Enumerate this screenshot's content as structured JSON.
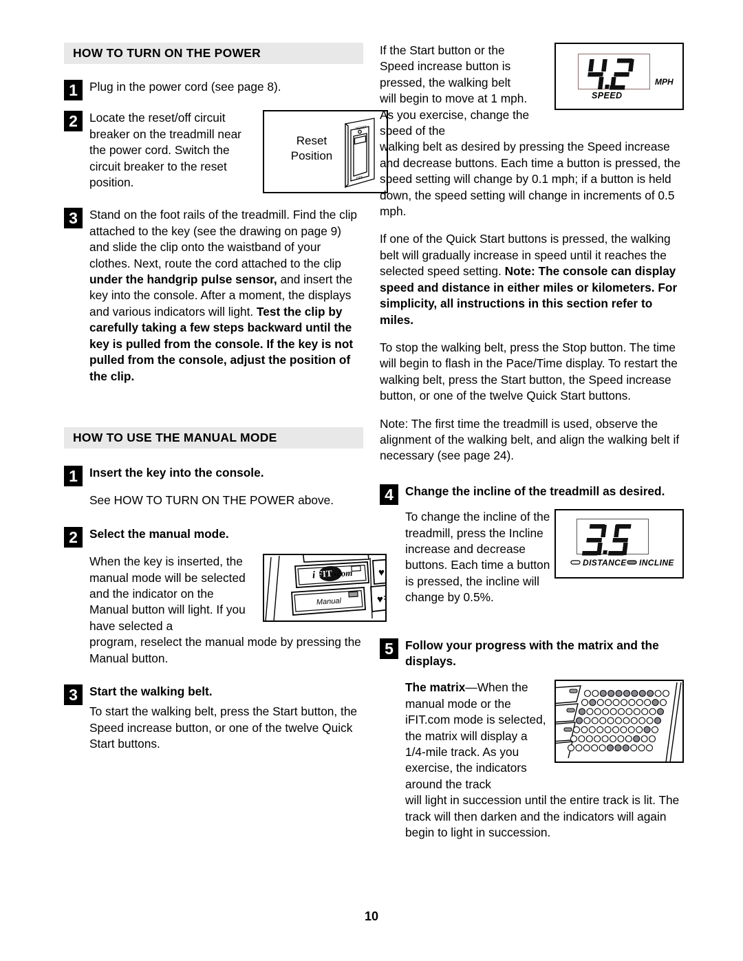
{
  "page": {
    "number": "10"
  },
  "left_column": {
    "section1": {
      "heading": "HOW TO TURN ON THE POWER",
      "steps": [
        {
          "num": "1",
          "text": "Plug in the power cord (see page 8)."
        },
        {
          "num": "2",
          "text": "Locate the reset/off circuit breaker on the treadmill near the power cord. Switch the circuit breaker to the reset position."
        },
        {
          "num": "3",
          "text_plain_1": "Stand on the foot rails of the treadmill. Find the clip attached to the key (see the drawing on page 9) and slide the clip onto the waistband of your clothes. Next, route the cord attached to the clip ",
          "text_bold_1": "under the handgrip pulse sensor,",
          "text_plain_2": " and insert the key into the console. After a moment, the displays and various indicators will light. ",
          "text_bold_2": "Test the clip by carefully taking a few steps backward until the key is pulled from the console. If the key is not pulled from the console, adjust the position of the clip."
        }
      ],
      "breaker_figure": {
        "label_line1": "Reset",
        "label_line2": "Position",
        "switch_top_label": "RESET",
        "switch_bottom_label": "OFF"
      }
    },
    "section2": {
      "heading": "HOW TO USE THE MANUAL MODE",
      "steps": [
        {
          "num": "1",
          "title": "Insert the key into the console.",
          "body": "See HOW TO TURN ON THE POWER above."
        },
        {
          "num": "2",
          "title": "Select the manual mode.",
          "body_narrow": "When the key is inserted, the manual mode will be selected and the indicator on the Manual button will light. If you have selected a",
          "body_full": "program, reselect the manual mode by pressing the Manual button."
        },
        {
          "num": "3",
          "title": "Start the walking belt.",
          "body": "To start the walking belt, press the Start button, the Speed increase button, or one of the twelve Quick Start buttons."
        }
      ],
      "console_figure": {
        "ifit_label": "iFIT.com",
        "manual_label": "Manual"
      }
    }
  },
  "right_column": {
    "para1": "If the Start button or the Speed increase button is pressed, the walking belt will begin to move at 1 mph. As you exercise, change the speed of the",
    "para1_cont": "walking belt as desired by pressing the Speed increase and decrease buttons. Each time a button is pressed, the speed setting will change by 0.1 mph; if a button is held down, the speed setting will change in increments of 0.5 mph.",
    "para2_plain": "If one of the Quick Start buttons is pressed, the walking belt will gradually increase in speed until it reaches the selected speed setting. ",
    "para2_bold": "Note: The console can display speed and distance in either miles or kilometers. For simplicity, all instructions in this section refer to miles.",
    "para3": "To stop the walking belt, press the Stop button. The time will begin to flash in the Pace/Time display. To restart the walking belt, press the Start button, the Speed increase button, or one of the twelve Quick Start buttons.",
    "para4": "Note: The first time the treadmill is used, observe the alignment of the walking belt, and align the walking belt if necessary (see page 24).",
    "speed_figure": {
      "value": "4.2",
      "unit": "MPH",
      "label": "SPEED"
    },
    "steps": [
      {
        "num": "4",
        "title": "Change the incline of the treadmill as desired.",
        "body": "To change the incline of the treadmill, press the Incline increase and decrease buttons. Each time a button is pressed, the incline will change by 0.5%."
      },
      {
        "num": "5",
        "title": "Follow your progress with the matrix and the displays.",
        "body_bold": "The matrix",
        "body_dash": "—",
        "body_narrow": "When the manual mode or the iFIT.com mode is selected, the matrix will display a 1/4-mile track. As you exercise, the indicators around the track",
        "body_full": "will light in succession until the entire track is lit. The track will then darken and the indicators will again begin to light in succession."
      }
    ],
    "incline_figure": {
      "value": "3.5",
      "label_distance": "DISTANCE",
      "label_incline": "INCLINE"
    },
    "matrix_figure": {
      "rows": 7,
      "cols": 11,
      "filled": [
        [
          0,
          0,
          1,
          1,
          1,
          1,
          1,
          1,
          1,
          0,
          0
        ],
        [
          0,
          1,
          0,
          0,
          0,
          0,
          0,
          0,
          0,
          1,
          0
        ],
        [
          1,
          0,
          0,
          0,
          0,
          0,
          0,
          0,
          0,
          0,
          1
        ],
        [
          1,
          0,
          0,
          0,
          0,
          0,
          0,
          0,
          0,
          0,
          1
        ],
        [
          0,
          0,
          0,
          0,
          0,
          0,
          0,
          0,
          0,
          1,
          0
        ],
        [
          0,
          0,
          0,
          0,
          0,
          0,
          0,
          0,
          1,
          0,
          0
        ],
        [
          0,
          0,
          0,
          0,
          0,
          1,
          1,
          1,
          0,
          0,
          0
        ]
      ],
      "dot_on_color": "#8a8a92",
      "dot_off_color": "#ffffff"
    }
  },
  "colors": {
    "header_band": "#e8e8e8",
    "badge_bg": "#000000",
    "text": "#000000"
  }
}
